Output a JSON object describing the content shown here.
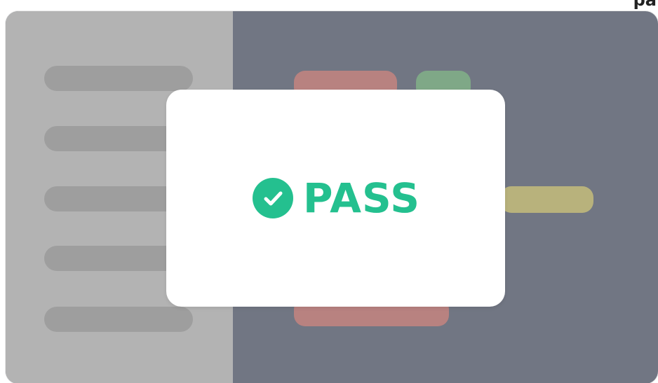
{
  "corner_text": "pa",
  "status": {
    "label": "PASS",
    "icon": "check-circle-icon",
    "color": "#24c08f"
  },
  "colors": {
    "left_panel": "#b3b3b3",
    "right_panel": "#717683",
    "skeleton": "#9e9e9e",
    "bar_red": "#b88280",
    "bar_green": "#7fa887",
    "bar_yellow": "#b8b27c"
  }
}
